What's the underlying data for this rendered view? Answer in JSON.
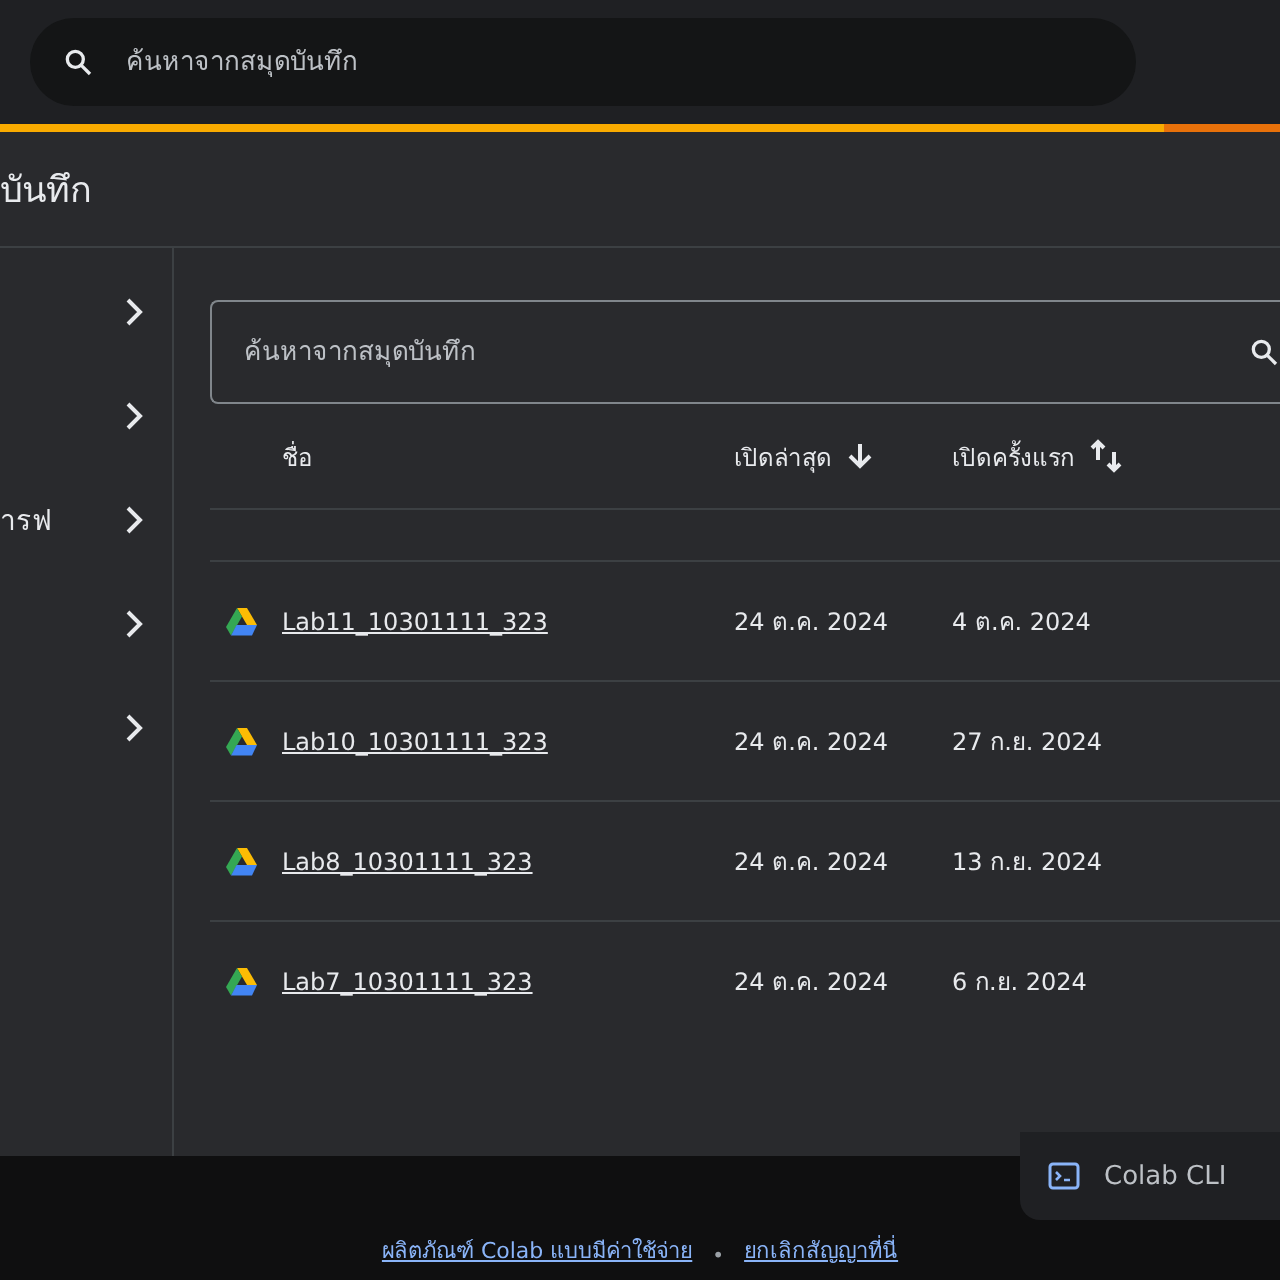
{
  "top_search": {
    "placeholder": "ค้นหาจากสมุดบันทึก"
  },
  "progress": {
    "level": 0.91
  },
  "dialog": {
    "title": "บันทึก",
    "sidebar": {
      "items": [
        {
          "expandable": true
        },
        {
          "expandable": true
        },
        {
          "label": "ารฟ",
          "expandable": true
        },
        {
          "expandable": true
        },
        {
          "expandable": true
        }
      ]
    },
    "search": {
      "placeholder": "ค้นหาจากสมุดบันทึก"
    },
    "table": {
      "columns": [
        {
          "label": "ชื่อ",
          "kind": "plain"
        },
        {
          "label": "เปิดล่าสุด",
          "kind": "sorted-desc"
        },
        {
          "label": "เปิดครั้งแรก",
          "kind": "sortable"
        }
      ],
      "rows": [
        {
          "name": "Lab11_10301111_323",
          "last_opened": "24 ต.ค. 2024",
          "first_opened": "4 ต.ค. 2024"
        },
        {
          "name": "Lab10_10301111_323",
          "last_opened": "24 ต.ค. 2024",
          "first_opened": "27 ก.ย. 2024"
        },
        {
          "name": "Lab8_10301111_323",
          "last_opened": "24 ต.ค. 2024",
          "first_opened": "13 ก.ย. 2024"
        },
        {
          "name": "Lab7_10301111_323",
          "last_opened": "24 ต.ค. 2024",
          "first_opened": "6 ก.ย. 2024"
        }
      ]
    }
  },
  "cli_button": {
    "label": "Colab CLI"
  },
  "footer": {
    "links": [
      "ผลิตภัณฑ์ Colab แบบมีค่าใช้จ่าย",
      "ยกเลิกสัญญาที่นี่"
    ],
    "separator": "•"
  }
}
